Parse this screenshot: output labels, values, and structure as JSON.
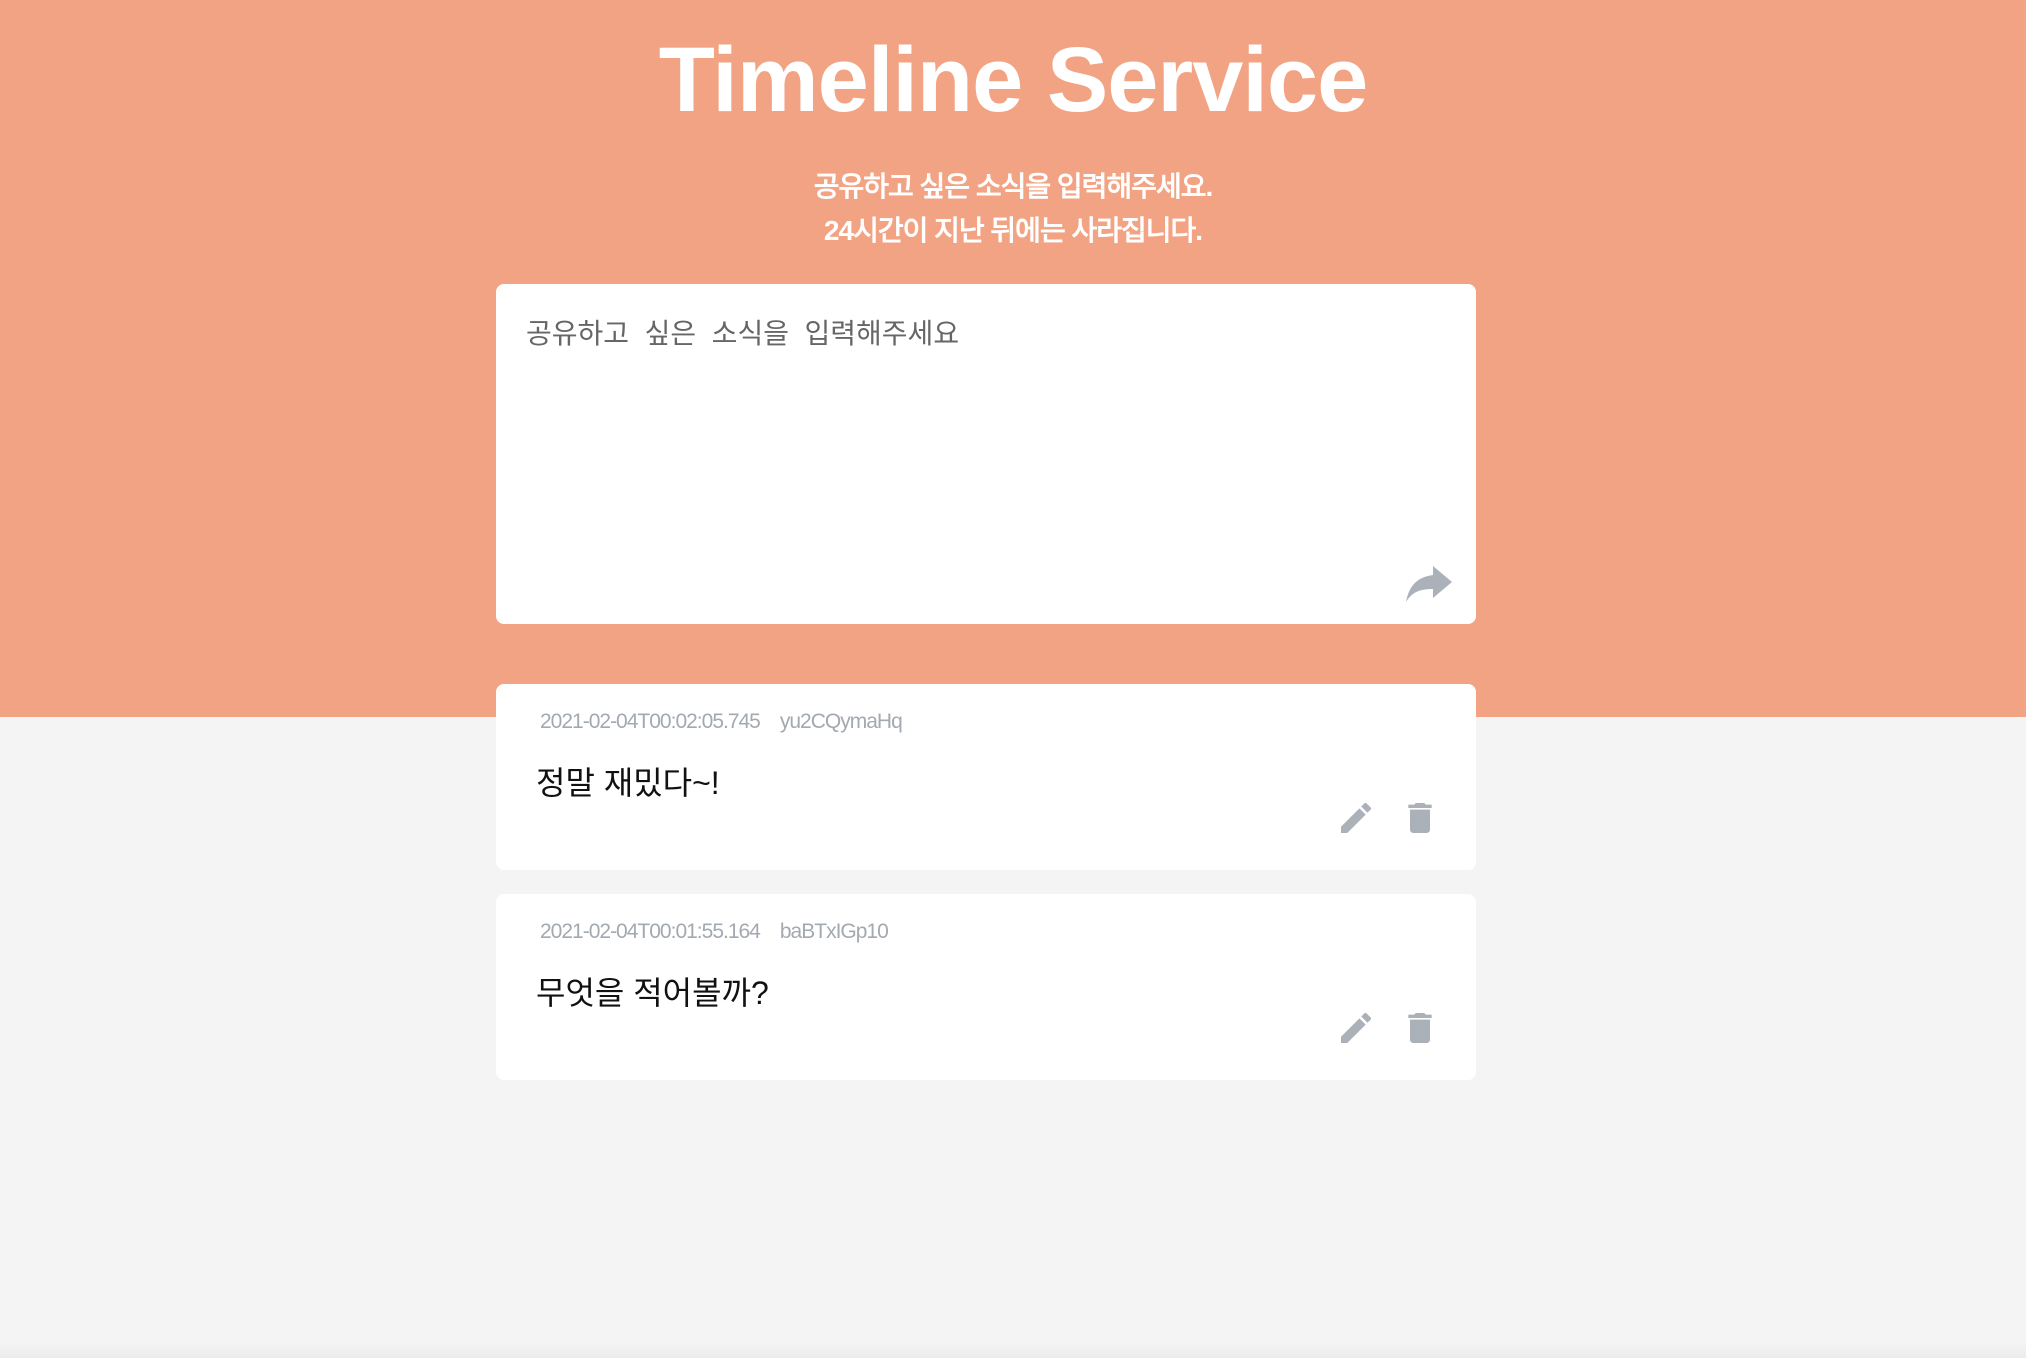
{
  "header": {
    "title": "Timeline Service",
    "subtitle_line1": "공유하고 싶은 소식을 입력해주세요.",
    "subtitle_line2": "24시간이 지난 뒤에는 사라집니다."
  },
  "composer": {
    "placeholder": "공유하고  싶은  소식을  입력해주세요",
    "value": "",
    "submit_icon": "share-arrow-icon"
  },
  "posts": [
    {
      "timestamp": "2021-02-04T00:02:05.745",
      "author": "yu2CQymaHq",
      "content": "정말 재밌다~!",
      "edit_icon": "pencil-icon",
      "delete_icon": "trash-icon"
    },
    {
      "timestamp": "2021-02-04T00:01:55.164",
      "author": "baBTxIGp10",
      "content": "무엇을 적어볼까?",
      "edit_icon": "pencil-icon",
      "delete_icon": "trash-icon"
    }
  ],
  "colors": {
    "hero_background": "#f2a383",
    "page_background": "#f4f4f4",
    "card_background": "#ffffff",
    "icon_gray": "#aab1b8"
  }
}
